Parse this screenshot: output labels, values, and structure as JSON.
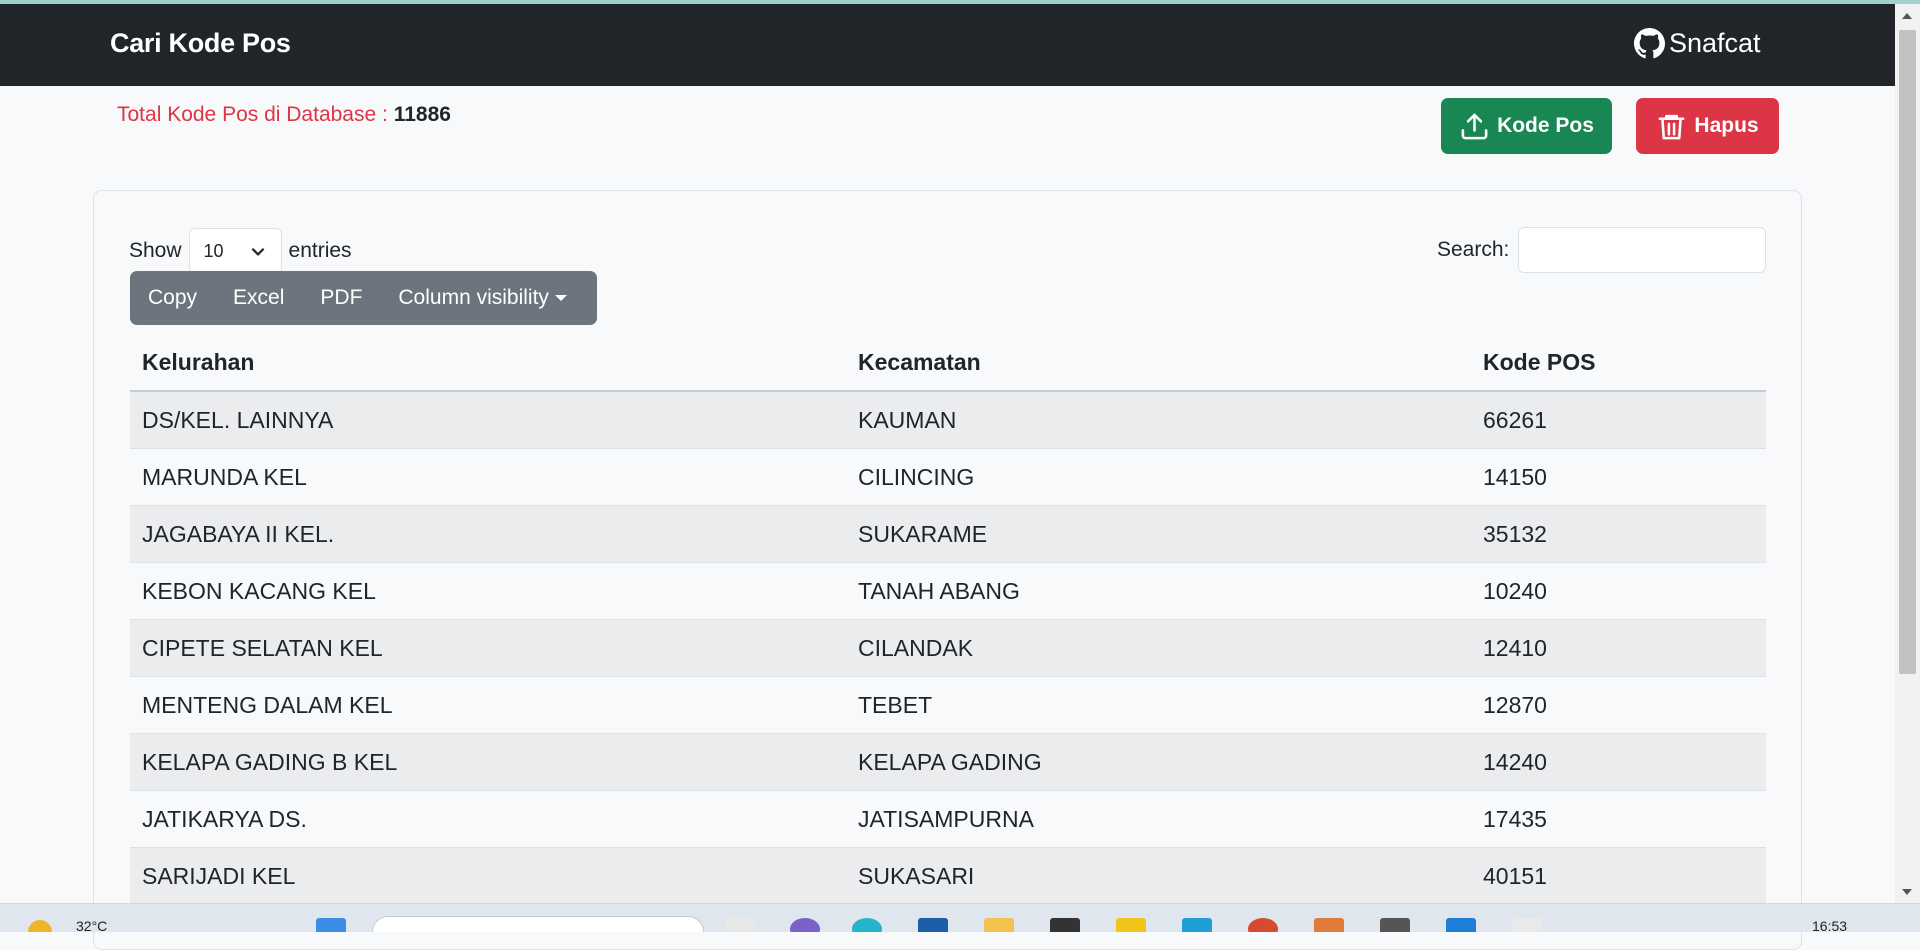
{
  "navbar": {
    "brand": "Cari Kode Pos",
    "github_label": "Snafcat"
  },
  "summary": {
    "label": "Total Kode Pos di Database :",
    "count": "11886"
  },
  "actions": {
    "upload_label": "Kode Pos",
    "delete_label": "Hapus"
  },
  "table_controls": {
    "show_label": "Show",
    "entries_value": "10",
    "entries_label": "entries",
    "search_label": "Search:",
    "search_value": ""
  },
  "export_buttons": [
    "Copy",
    "Excel",
    "PDF",
    "Column visibility"
  ],
  "table": {
    "headers": [
      "Kelurahan",
      "Kecamatan",
      "Kode POS"
    ],
    "rows": [
      [
        "DS/KEL. LAINNYA",
        "KAUMAN",
        "66261"
      ],
      [
        "MARUNDA KEL",
        "CILINCING",
        "14150"
      ],
      [
        "JAGABAYA II KEL.",
        "SUKARAME",
        "35132"
      ],
      [
        "KEBON KACANG KEL",
        "TANAH ABANG",
        "10240"
      ],
      [
        "CIPETE SELATAN KEL",
        "CILANDAK",
        "12410"
      ],
      [
        "MENTENG DALAM KEL",
        "TEBET",
        "12870"
      ],
      [
        "KELAPA GADING B KEL",
        "KELAPA GADING",
        "14240"
      ],
      [
        "JATIKARYA DS.",
        "JATISAMPURNA",
        "17435"
      ],
      [
        "SARIJADI KEL",
        "SUKASARI",
        "40151"
      ]
    ]
  },
  "taskbar": {
    "temperature": "32°C",
    "time": "16:53"
  },
  "colors": {
    "navbar": "#212529",
    "success": "#198754",
    "danger": "#dc3545",
    "secondary": "#6c757d"
  }
}
